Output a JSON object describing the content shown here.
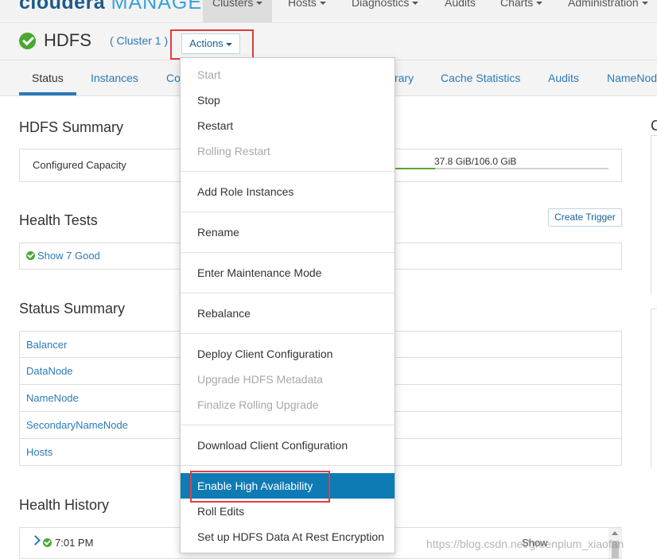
{
  "app": {
    "logo_main": "cloudera",
    "logo_sub": "MANAGER"
  },
  "topnav": {
    "items": [
      {
        "label": "Clusters"
      },
      {
        "label": "Hosts"
      },
      {
        "label": "Diagnostics"
      },
      {
        "label": "Audits"
      },
      {
        "label": "Charts"
      },
      {
        "label": "Administration"
      }
    ]
  },
  "service": {
    "name": "HDFS",
    "cluster_link": "( Cluster 1 )",
    "actions_label": "Actions"
  },
  "tabs": [
    {
      "label": "Status"
    },
    {
      "label": "Instances"
    },
    {
      "label": "Co"
    },
    {
      "label": "rary"
    },
    {
      "label": "Cache Statistics"
    },
    {
      "label": "Audits"
    },
    {
      "label": "NameNod"
    }
  ],
  "summary": {
    "title": "HDFS Summary",
    "capacity_label": "Configured Capacity",
    "capacity_value": "37.8 GiB/106.0 GiB",
    "capacity_used_gib": 37.8,
    "capacity_total_gib": 106.0
  },
  "health_tests": {
    "title": "Health Tests",
    "create_trigger": "Create Trigger",
    "show_good": "Show 7 Good"
  },
  "status_summary": {
    "title": "Status Summary",
    "rows": [
      {
        "label": "Balancer"
      },
      {
        "label": "DataNode"
      },
      {
        "label": "NameNode"
      },
      {
        "label": "SecondaryNameNode"
      },
      {
        "label": "Hosts"
      }
    ]
  },
  "health_history": {
    "title": "Health History",
    "entry_time": "7:01 PM",
    "entry_show": "Show"
  },
  "right_edge": {
    "partial_title": "C"
  },
  "actions_menu": {
    "items": [
      {
        "label": "Start",
        "disabled": true
      },
      {
        "label": "Stop",
        "disabled": false
      },
      {
        "label": "Restart",
        "disabled": false
      },
      {
        "label": "Rolling Restart",
        "disabled": true
      },
      {
        "label": "Add Role Instances",
        "disabled": false
      },
      {
        "label": "Rename",
        "disabled": false
      },
      {
        "label": "Enter Maintenance Mode",
        "disabled": false
      },
      {
        "label": "Rebalance",
        "disabled": false
      },
      {
        "label": "Deploy Client Configuration",
        "disabled": false
      },
      {
        "label": "Upgrade HDFS Metadata",
        "disabled": true
      },
      {
        "label": "Finalize Rolling Upgrade",
        "disabled": true
      },
      {
        "label": "Download Client Configuration",
        "disabled": false
      },
      {
        "label": "Enable High Availability",
        "disabled": false,
        "selected": true
      },
      {
        "label": "Roll Edits",
        "disabled": false
      },
      {
        "label": "Set up HDFS Data At Rest Encryption",
        "disabled": false
      }
    ]
  },
  "watermark": "https://blog.csdn.net/greenplum_xiaofan",
  "colors": {
    "accent": "#2a7ab8",
    "selected_bg": "#0f7bb5",
    "ok_green": "#4aa832",
    "highlight_red": "#e03c3c"
  }
}
